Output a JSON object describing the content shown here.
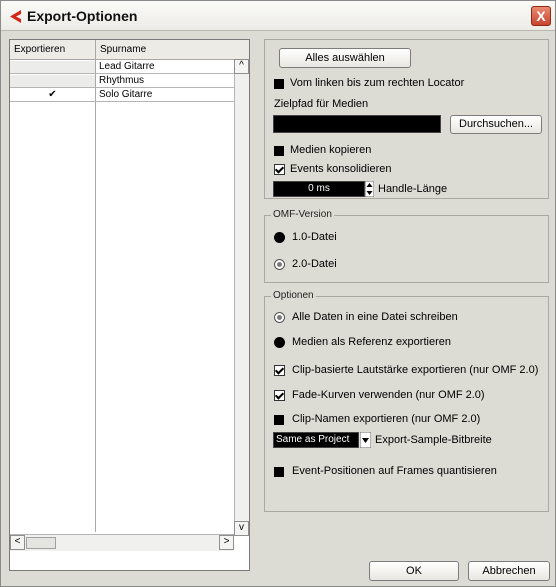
{
  "window": {
    "title": "Export-Optionen",
    "close_glyph": "X"
  },
  "tracklist": {
    "col_export": "Exportieren",
    "col_name": "Spurname",
    "rows": [
      {
        "checked": "",
        "name": "Lead Gitarre"
      },
      {
        "checked": "",
        "name": "Rhythmus"
      },
      {
        "checked": "✔",
        "name": "Solo Gitarre"
      }
    ]
  },
  "top_panel": {
    "select_all": "Alles auswählen",
    "locator": "Vom linken bis zum rechten Locator",
    "target_path_label": "Zielpfad für Medien",
    "target_path_value": "",
    "browse": "Durchsuchen...",
    "copy_media": "Medien kopieren",
    "consolidate": "Events konsolidieren",
    "handle_value": "0 ms",
    "handle_label": "Handle-Länge"
  },
  "omf_panel": {
    "legend": "OMF-Version",
    "opt1": "1.0-Datei",
    "opt2": "2.0-Datei"
  },
  "options_panel": {
    "legend": "Optionen",
    "all_in_one": "Alle Daten in eine Datei schreiben",
    "media_reference": "Medien als Referenz exportieren",
    "clip_volume": "Clip-basierte Lautstärke exportieren (nur OMF 2.0)",
    "fade_curves": "Fade-Kurven verwenden (nur OMF 2.0)",
    "clip_names": "Clip-Namen exportieren (nur OMF 2.0)",
    "bitdepth_value": "Same as Project",
    "bitdepth_label": "Export-Sample-Bitbreite",
    "quantize": "Event-Positionen auf Frames quantisieren"
  },
  "footer": {
    "ok": "OK",
    "cancel": "Abbrechen"
  }
}
